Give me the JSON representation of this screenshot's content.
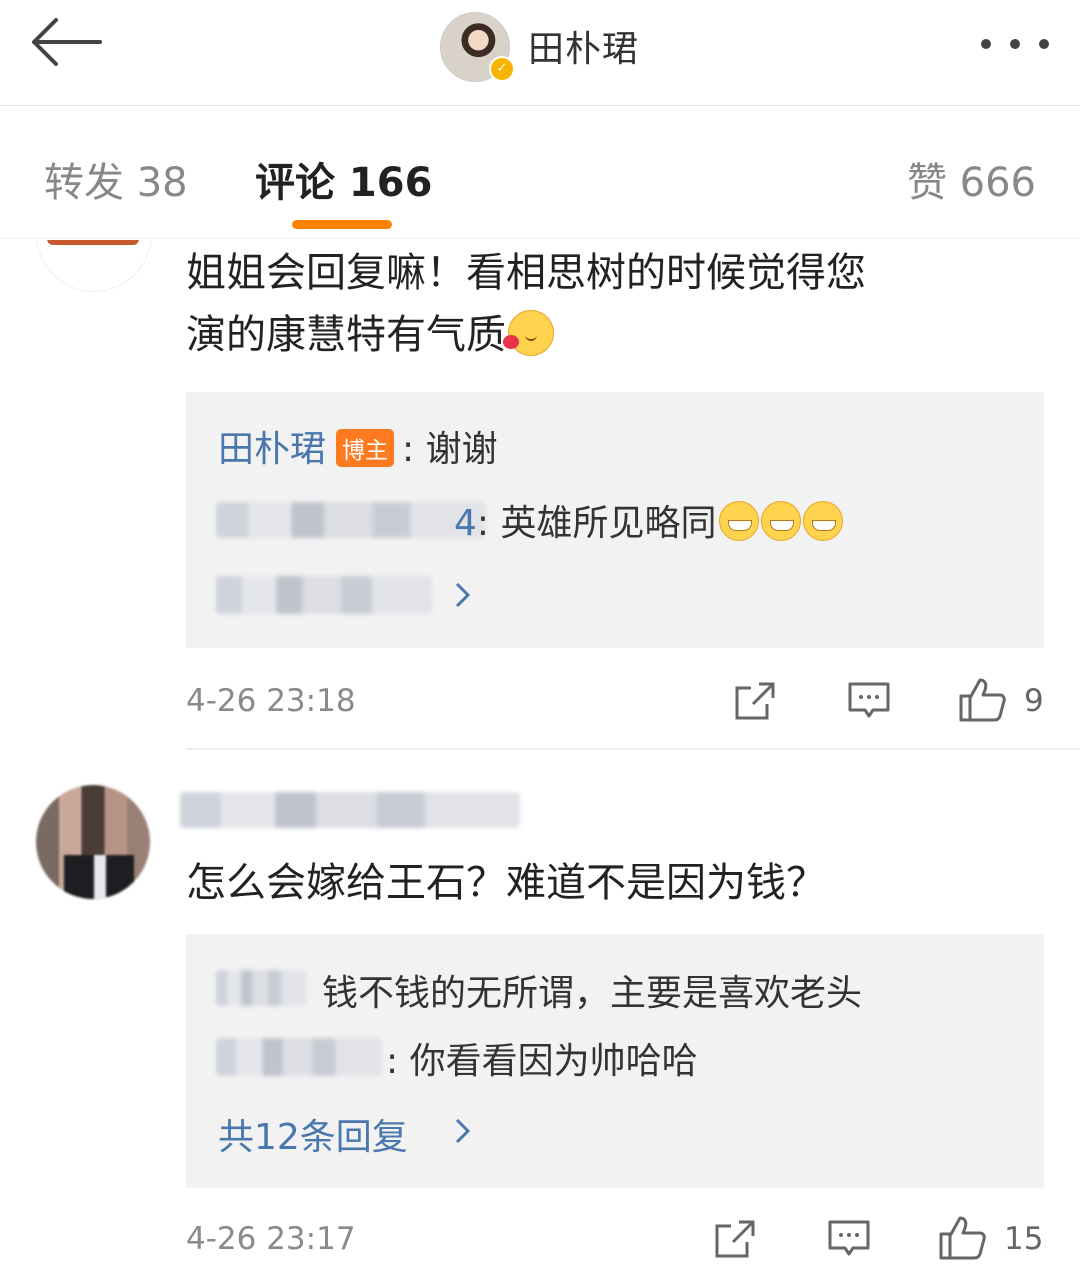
{
  "header": {
    "title": "田朴珺",
    "back_icon": "back-arrow-icon",
    "more_icon": "more-dots-icon"
  },
  "tabs": {
    "repost": "转发 38",
    "comment": "评论 166",
    "like": "赞 666"
  },
  "colors": {
    "accent": "#ff8200",
    "link": "#4a78ad",
    "reply_bg": "#f2f2f2"
  },
  "comments": [
    {
      "text_line1": "姐姐会回复嘛！看相思树的时候觉得您",
      "text_line2": "演的康慧特有气质",
      "replies": {
        "blogger_name": "田朴珺",
        "blogger_tag": "博主",
        "blogger_reply": "谢谢",
        "reply2_name_tail": "4",
        "reply2_text": "英雄所见略同"
      },
      "time": "4-26 23:18",
      "like_count": "9"
    },
    {
      "text": "怎么会嫁给王石？难道不是因为钱？",
      "replies": {
        "reply1_text": "钱不钱的无所谓，主要是喜欢老头",
        "reply2_name_tail": "",
        "reply2_text": "你看看因为帅哈哈",
        "more_link": "共12条回复"
      },
      "time": "4-26 23:17",
      "like_count": "15"
    }
  ]
}
